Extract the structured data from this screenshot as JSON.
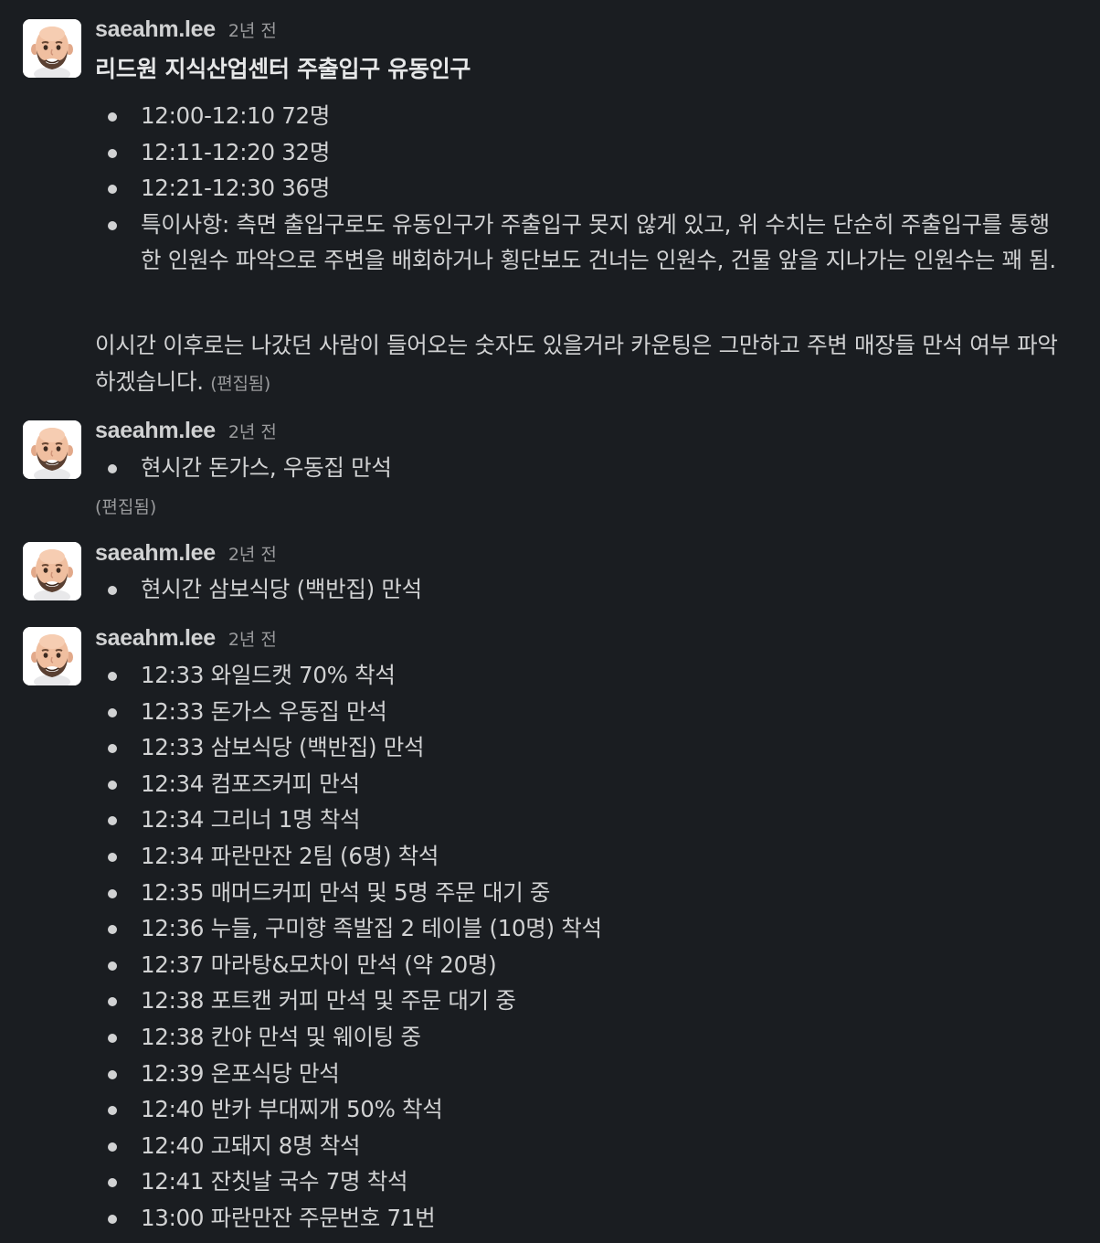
{
  "messages": [
    {
      "username": "saeahm.lee",
      "time": "2년 전",
      "title": "리드원 지식산업센터 주출입구 유동인구",
      "bullets": [
        "12:00-12:10 72명",
        "12:11-12:20 32명",
        "12:21-12:30 36명",
        "특이사항: 측면 출입구로도 유동인구가 주출입구 못지 않게 있고, 위 수치는 단순히 주출입구를 통행한 인원수 파악으로 주변을 배회하거나 횡단보도 건너는 인원수, 건물 앞을 지나가는 인원수는 꽤 됨."
      ],
      "paragraph": "이시간 이후로는 나갔던 사람이 들어오는 숫자도 있을거라 카운팅은 그만하고 주변 매장들 만석 여부 파악하겠습니다.",
      "edited": "(편집됨)"
    },
    {
      "username": "saeahm.lee",
      "time": "2년 전",
      "bullets": [
        "현시간 돈가스, 우동집 만석"
      ],
      "edited": "(편집됨)"
    },
    {
      "username": "saeahm.lee",
      "time": "2년 전",
      "bullets": [
        "현시간 삼보식당 (백반집) 만석"
      ]
    },
    {
      "username": "saeahm.lee",
      "time": "2년 전",
      "bullets": [
        "12:33 와일드캣 70% 착석",
        "12:33 돈가스 우동집 만석",
        "12:33 삼보식당 (백반집) 만석",
        "12:34 컴포즈커피 만석",
        "12:34 그리너 1명 착석",
        "12:34 파란만잔 2팀 (6명) 착석",
        "12:35 매머드커피 만석 및 5명 주문 대기 중",
        "12:36 누들, 구미향 족발집 2 테이블 (10명) 착석",
        "12:37 마라탕&모차이 만석 (약 20명)",
        "12:38 포트캔 커피 만석 및 주문 대기 중",
        "12:38 칸야 만석 및 웨이팅 중",
        "12:39 온포식당 만석",
        "12:40 반카 부대찌개 50% 착석",
        "12:40 고돼지 8명 착석",
        "12:41 잔칫날 국수 7명 착석",
        "13:00 파란만잔 주문번호 71번"
      ]
    }
  ]
}
